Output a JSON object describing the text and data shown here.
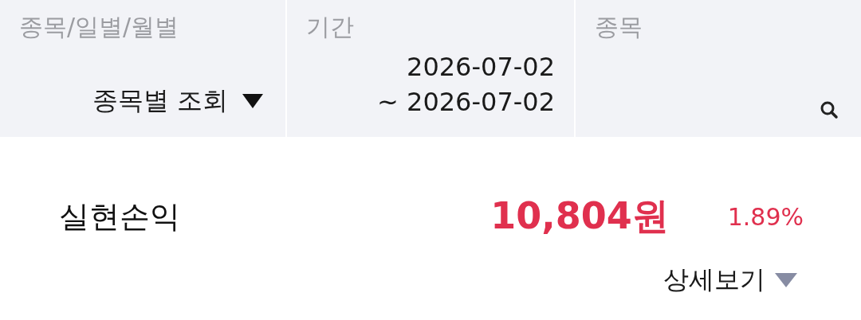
{
  "filters": [
    {
      "kind": "dropdown",
      "label": "종목/일별/월별",
      "value": "종목별 조회"
    },
    {
      "kind": "range",
      "label": "기간",
      "lines": [
        "2026-07-02",
        "~ 2026-07-02"
      ]
    },
    {
      "kind": "search",
      "label": "종목"
    }
  ],
  "summary": {
    "label": "실현손익",
    "amount": "10,804원",
    "rate": "1.89%"
  },
  "details_link": "상세보기"
}
